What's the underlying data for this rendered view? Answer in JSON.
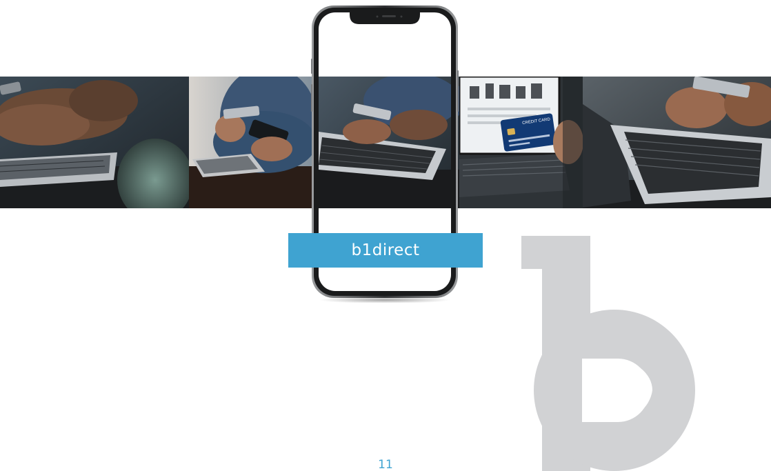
{
  "brand": {
    "name": "b1direct",
    "accent_color": "#3fa3d1",
    "mark_color": "#d1d2d4"
  },
  "photos": [
    {
      "subject": "hands-laptop-card-photo"
    },
    {
      "subject": "phone-card-payment-photo"
    },
    {
      "subject": "laptop-typing-card-photo"
    },
    {
      "subject": "credit-card-online-shop-photo",
      "card_text": "CREDIT CARD"
    },
    {
      "subject": "laptop-keyboard-card-photo"
    }
  ],
  "page": {
    "number": "11"
  }
}
